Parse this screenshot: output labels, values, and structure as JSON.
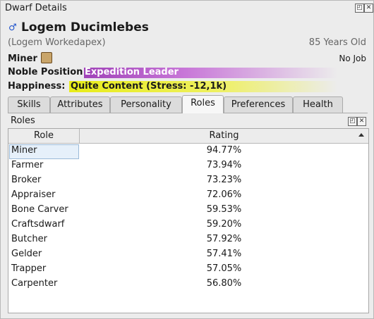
{
  "window": {
    "title": "Dwarf Details",
    "restore_icon": "◰",
    "close_icon": "✕"
  },
  "dwarf": {
    "name": "Logem Ducimlebes",
    "gender_icon": "♂",
    "nickname": "(Logem Workedapex)",
    "age": "85 Years Old",
    "profession": "Miner",
    "job": "No Job",
    "noble_label": "Noble Position",
    "noble_value": "Expedition Leader",
    "happiness_label": "Happiness:",
    "happiness_value": "Quite Content (Stress: -12,1k)"
  },
  "tabs": [
    {
      "label": "Skills"
    },
    {
      "label": "Attributes"
    },
    {
      "label": "Personality"
    },
    {
      "label": "Roles",
      "active": true
    },
    {
      "label": "Preferences"
    },
    {
      "label": "Health"
    }
  ],
  "roles_panel": {
    "title": "Roles",
    "columns": [
      "Role",
      "Rating"
    ],
    "rows": [
      {
        "role": "Miner",
        "rating": "94.77%"
      },
      {
        "role": "Farmer",
        "rating": "73.94%"
      },
      {
        "role": "Broker",
        "rating": "73.23%"
      },
      {
        "role": "Appraiser",
        "rating": "72.06%"
      },
      {
        "role": "Bone Carver",
        "rating": "59.53%"
      },
      {
        "role": "Craftsdwarf",
        "rating": "59.20%"
      },
      {
        "role": "Butcher",
        "rating": "57.92%"
      },
      {
        "role": "Gelder",
        "rating": "57.41%"
      },
      {
        "role": "Trapper",
        "rating": "57.05%"
      },
      {
        "role": "Carpenter",
        "rating": "56.80%"
      }
    ]
  }
}
